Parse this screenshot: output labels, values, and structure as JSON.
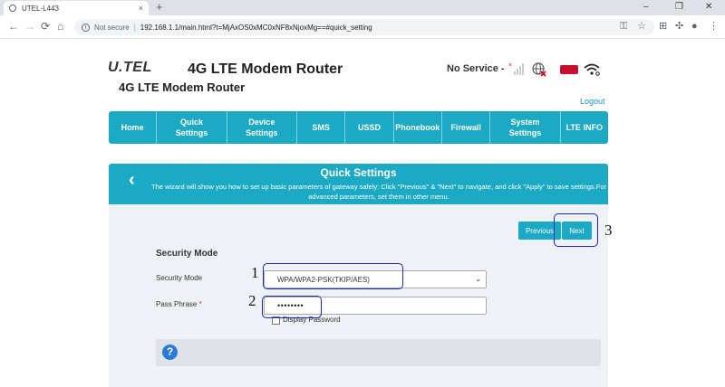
{
  "browser": {
    "tab_title": "UTEL-L443",
    "tab_close": "×",
    "new_tab": "+",
    "window_controls": [
      "–",
      "❐",
      "✕"
    ],
    "nav_buttons": [
      "←",
      "→",
      "⟳",
      "⌂"
    ],
    "not_secure": "Not secure",
    "separator": "|",
    "url": "192.168.1.1/main.html?t=MjAxOS0xMC0xNF8xNjoxMg==#quick_setting",
    "toolbar_icons": [
      "key-icon",
      "star-icon",
      "extension-grid-icon",
      "puzzle-icon",
      "profile-icon",
      "menu-dots-icon"
    ]
  },
  "header": {
    "logo_text": "U.TEL",
    "title_main": "4G LTE Modem Router",
    "title_sub": "4G LTE Modem Router",
    "status": "No Service -",
    "logout": "Logout"
  },
  "nav": {
    "items": [
      {
        "label": "Home"
      },
      {
        "label": "Quick Settings"
      },
      {
        "label": "Device Settings"
      },
      {
        "label": "SMS"
      },
      {
        "label": "USSD"
      },
      {
        "label": "Phonebook"
      },
      {
        "label": "Firewall"
      },
      {
        "label": "System Settings"
      },
      {
        "label": "LTE INFO"
      }
    ]
  },
  "quick_settings": {
    "back": "‹",
    "title": "Quick Settings",
    "description": "The wizard will show you how to set up basic parameters of gateway safely: Click \"Previous\" & \"Next\" to navigate, and click \"Apply\" to save settings.For advanced parameters, set them in other menu.",
    "previous_label": "Previous",
    "next_label": "Next",
    "section_title": "Security Mode",
    "security_mode_label": "Security Mode",
    "security_mode_value": "WPA/WPA2-PSK(TKIP/AES)",
    "pass_phrase_label": "Pass Phrase",
    "required_mark": "*",
    "pass_phrase_value": "••••••••",
    "display_password_label": "Display Password",
    "display_password_checked": false,
    "help_icon": "?"
  },
  "annotations": {
    "labels": [
      "1",
      "2",
      "3"
    ],
    "color": "#1c25c9"
  },
  "colors": {
    "accent": "#1ba9c4",
    "battery": "#c8102e",
    "signal_x": "#d0021b"
  }
}
